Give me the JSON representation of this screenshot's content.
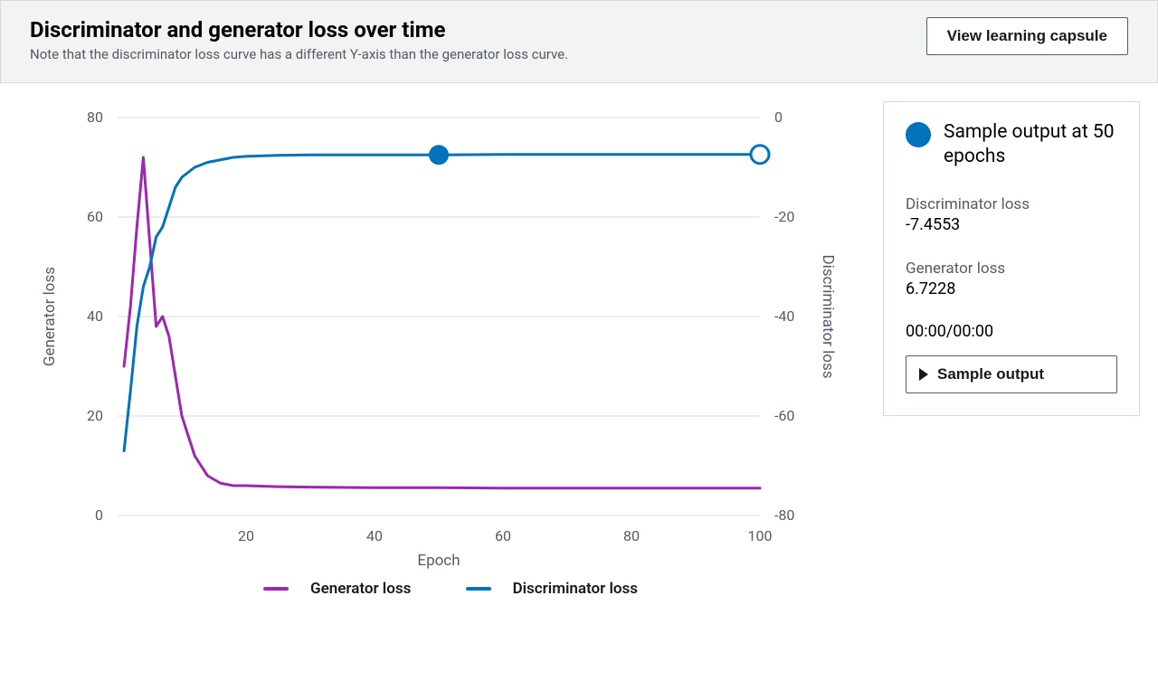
{
  "header": {
    "title": "Discriminator and generator loss over time",
    "subtitle": "Note that the discriminator loss curve has a different Y-axis than the generator loss curve.",
    "view_btn": "View learning capsule"
  },
  "panel": {
    "sample_title": "Sample output at 50 epochs",
    "disc_label": "Discriminator loss",
    "disc_value": "-7.4553",
    "gen_label": "Generator loss",
    "gen_value": "6.7228",
    "time": "00:00/00:00",
    "sample_btn": "Sample output"
  },
  "legend": {
    "gen": "Generator loss",
    "disc": "Discriminator loss"
  },
  "chart_data": {
    "type": "line",
    "xlabel": "Epoch",
    "y_left_label": "Generator loss",
    "y_right_label": "Discriminator loss",
    "x_range": [
      0,
      100
    ],
    "y_left_range": [
      0,
      80
    ],
    "y_right_range": [
      -80,
      0
    ],
    "x_ticks": [
      20,
      40,
      60,
      80,
      100
    ],
    "y_left_ticks": [
      0,
      20,
      40,
      60,
      80
    ],
    "y_right_ticks": [
      0,
      -20,
      -40,
      -60,
      -80
    ],
    "marker_epoch": 50,
    "end_epoch": 100,
    "series": [
      {
        "name": "Generator loss",
        "axis": "left",
        "color": "#9c27b0",
        "values": [
          {
            "x": 1,
            "y": 30
          },
          {
            "x": 2,
            "y": 42
          },
          {
            "x": 3,
            "y": 58
          },
          {
            "x": 4,
            "y": 72
          },
          {
            "x": 5,
            "y": 55
          },
          {
            "x": 6,
            "y": 38
          },
          {
            "x": 7,
            "y": 40
          },
          {
            "x": 8,
            "y": 36
          },
          {
            "x": 9,
            "y": 28
          },
          {
            "x": 10,
            "y": 20
          },
          {
            "x": 12,
            "y": 12
          },
          {
            "x": 14,
            "y": 8
          },
          {
            "x": 16,
            "y": 6.5
          },
          {
            "x": 18,
            "y": 6
          },
          {
            "x": 20,
            "y": 6
          },
          {
            "x": 25,
            "y": 5.8
          },
          {
            "x": 30,
            "y": 5.7
          },
          {
            "x": 40,
            "y": 5.6
          },
          {
            "x": 50,
            "y": 5.6
          },
          {
            "x": 60,
            "y": 5.5
          },
          {
            "x": 70,
            "y": 5.5
          },
          {
            "x": 80,
            "y": 5.5
          },
          {
            "x": 90,
            "y": 5.5
          },
          {
            "x": 100,
            "y": 5.5
          }
        ]
      },
      {
        "name": "Discriminator loss",
        "axis": "right",
        "color": "#0073bb",
        "values": [
          {
            "x": 1,
            "y": -67
          },
          {
            "x": 2,
            "y": -55
          },
          {
            "x": 3,
            "y": -42
          },
          {
            "x": 4,
            "y": -34
          },
          {
            "x": 5,
            "y": -30
          },
          {
            "x": 6,
            "y": -24
          },
          {
            "x": 7,
            "y": -22
          },
          {
            "x": 8,
            "y": -18
          },
          {
            "x": 9,
            "y": -14
          },
          {
            "x": 10,
            "y": -12
          },
          {
            "x": 12,
            "y": -10
          },
          {
            "x": 14,
            "y": -9
          },
          {
            "x": 16,
            "y": -8.5
          },
          {
            "x": 18,
            "y": -8
          },
          {
            "x": 20,
            "y": -7.8
          },
          {
            "x": 25,
            "y": -7.6
          },
          {
            "x": 30,
            "y": -7.5
          },
          {
            "x": 40,
            "y": -7.5
          },
          {
            "x": 50,
            "y": -7.5
          },
          {
            "x": 60,
            "y": -7.4
          },
          {
            "x": 70,
            "y": -7.4
          },
          {
            "x": 80,
            "y": -7.4
          },
          {
            "x": 90,
            "y": -7.4
          },
          {
            "x": 100,
            "y": -7.4
          }
        ]
      }
    ]
  }
}
